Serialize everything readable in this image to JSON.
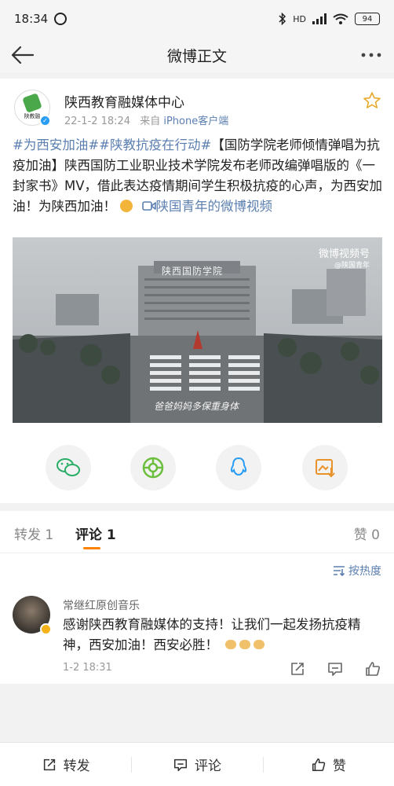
{
  "status_bar": {
    "time": "18:34",
    "network": "HD",
    "battery": "94"
  },
  "nav": {
    "title": "微博正文"
  },
  "post": {
    "author": "陕西教育融媒体中心",
    "avatar_caption": "陕教融",
    "date": "22-1-2 18:24",
    "source_prefix": "来自",
    "source": "iPhone客户端",
    "tag1": "#为西安加油#",
    "tag2": "#陕教抗疫在行动#",
    "text": "【国防学院老师倾情弹唱为抗疫加油】陕西国防工业职业技术学院发布老师改编弹唱版的《一封家书》MV，借此表达疫情期间学生积极抗疫的心声，为西安加油！为陕西加油！",
    "video_link": "陕国青年的微博视频",
    "video": {
      "watermark": "微博视频号",
      "watermark_sub": "@陕国青年",
      "building_sign": "陕西国防学院",
      "caption": "爸爸妈妈多保重身体"
    }
  },
  "share_icons": [
    "wechat-icon",
    "moments-icon",
    "qq-icon",
    "save-image-icon"
  ],
  "tabs": {
    "repost": "转发 1",
    "comment": "评论 1",
    "like": "赞 0"
  },
  "comments": {
    "sort_label": "按热度",
    "items": [
      {
        "name": "常继红原创音乐",
        "text": "感谢陕西教育融媒体的支持！让我们一起发扬抗疫精神，西安加油！西安必胜！",
        "time": "1-2 18:31"
      }
    ]
  },
  "bottom_bar": {
    "repost": "转发",
    "comment": "评论",
    "like": "赞"
  },
  "colors": {
    "link": "#5b7fb0",
    "accent": "#ff8200",
    "verified": "#2a9df4"
  }
}
